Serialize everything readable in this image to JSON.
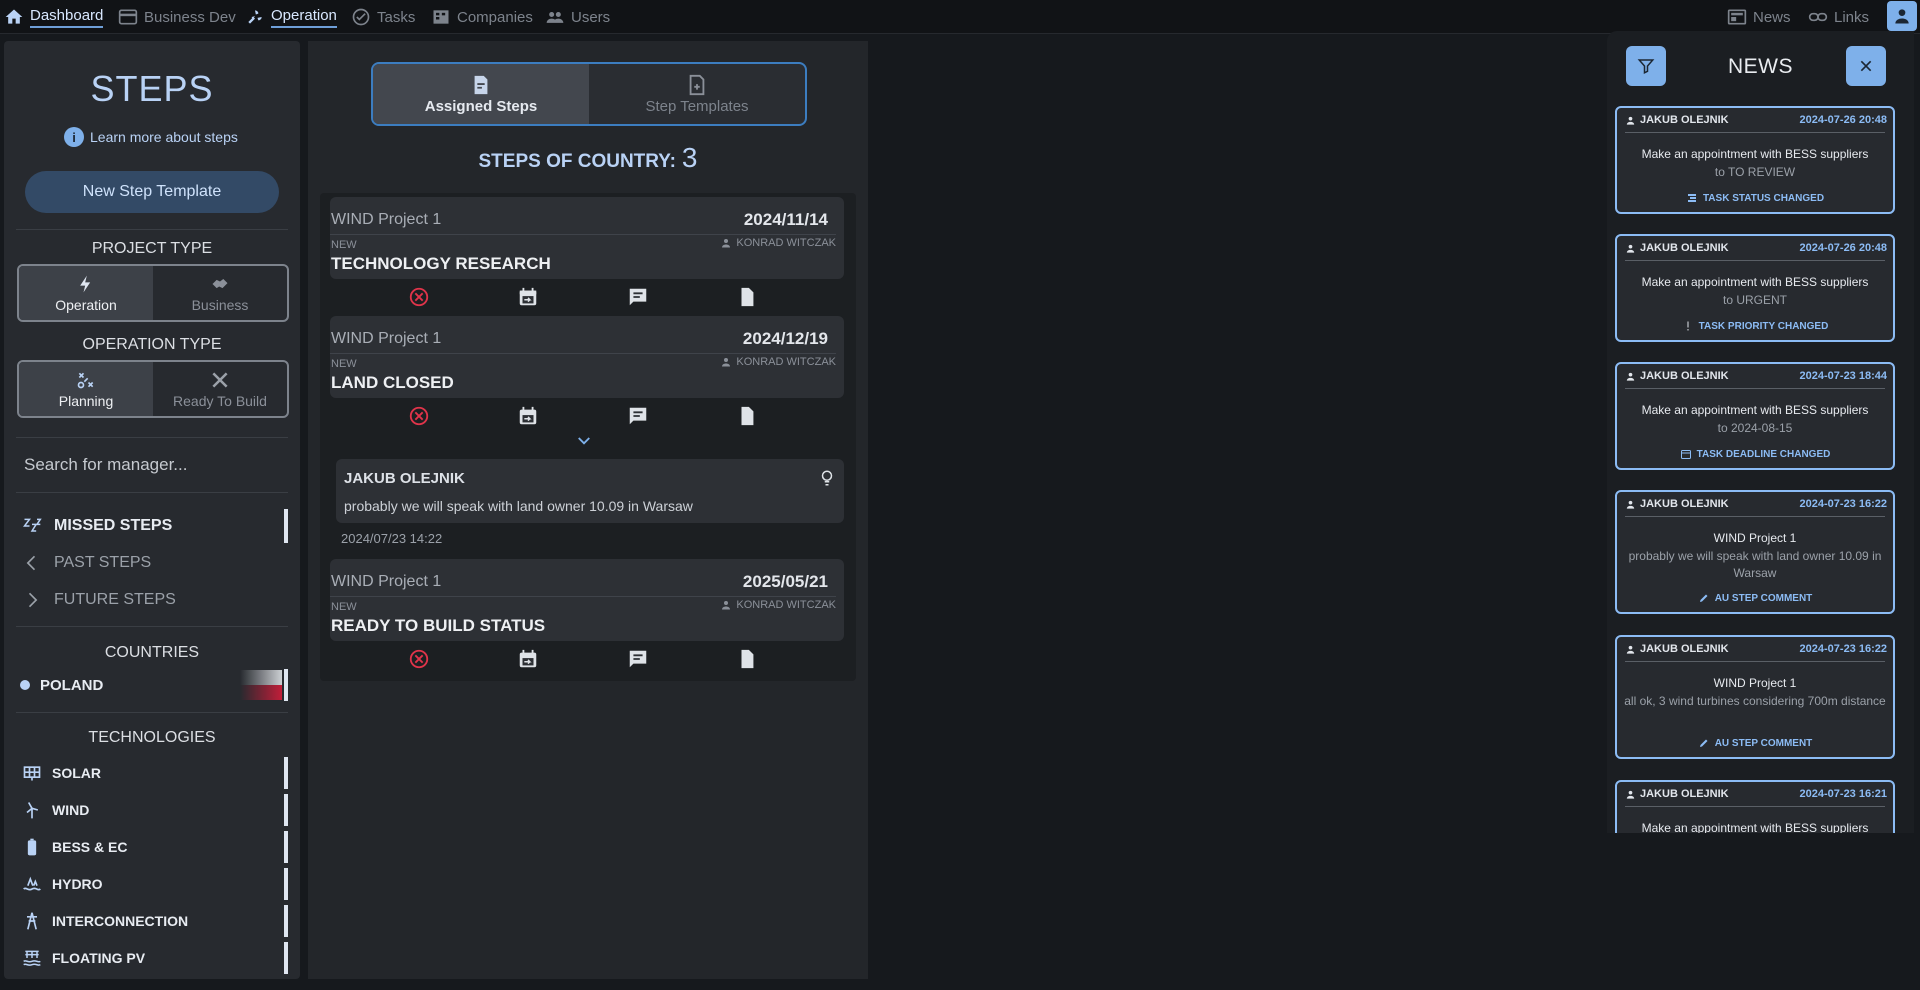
{
  "nav": {
    "items": [
      {
        "label": "Dashboard",
        "icon": "home-icon"
      },
      {
        "label": "Business Dev",
        "icon": "card-icon"
      },
      {
        "label": "Operation",
        "icon": "wind-tool-icon"
      },
      {
        "label": "Tasks",
        "icon": "check-circle-icon"
      },
      {
        "label": "Companies",
        "icon": "building-icon"
      },
      {
        "label": "Users",
        "icon": "users-icon"
      }
    ],
    "right": [
      {
        "label": "News",
        "icon": "newspaper-icon"
      },
      {
        "label": "Links",
        "icon": "link-icon"
      }
    ]
  },
  "sidebar": {
    "title": "STEPS",
    "learn_more": "Learn more about steps",
    "new_template": "New Step Template",
    "project_type_label": "PROJECT TYPE",
    "project_types": [
      "Operation",
      "Business"
    ],
    "operation_type_label": "OPERATION TYPE",
    "operation_types": [
      "Planning",
      "Ready To Build"
    ],
    "search_placeholder": "Search for manager...",
    "filters": [
      "MISSED STEPS",
      "PAST STEPS",
      "FUTURE STEPS"
    ],
    "countries_label": "COUNTRIES",
    "countries": [
      "POLAND"
    ],
    "technologies_label": "TECHNOLOGIES",
    "technologies": [
      "SOLAR",
      "WIND",
      "BESS & EC",
      "HYDRO",
      "INTERCONNECTION",
      "FLOATING PV"
    ]
  },
  "main": {
    "tabs": [
      "Assigned Steps",
      "Step Templates"
    ],
    "count_label": "STEPS OF COUNTRY:",
    "count_value": "3",
    "steps": [
      {
        "project": "WIND Project 1",
        "date": "2024/11/14",
        "status": "NEW",
        "owner": "KONRAD WITCZAK",
        "name": "TECHNOLOGY RESEARCH"
      },
      {
        "project": "WIND Project 1",
        "date": "2024/12/19",
        "status": "NEW",
        "owner": "KONRAD WITCZAK",
        "name": "LAND CLOSED"
      },
      {
        "project": "WIND Project 1",
        "date": "2025/05/21",
        "status": "NEW",
        "owner": "KONRAD WITCZAK",
        "name": "READY TO BUILD STATUS"
      }
    ],
    "comment": {
      "author": "JAKUB OLEJNIK",
      "text": "probably we will speak with land owner 10.09 in Warsaw",
      "time": "2024/07/23 14:22"
    }
  },
  "news": {
    "title": "NEWS",
    "items": [
      {
        "author": "JAKUB OLEJNIK",
        "time": "2024-07-26 20:48",
        "message": "Make an appointment with BESS suppliers",
        "detail": "to TO REVIEW",
        "kind": "TASK STATUS CHANGED"
      },
      {
        "author": "JAKUB OLEJNIK",
        "time": "2024-07-26 20:48",
        "message": "Make an appointment with BESS suppliers",
        "detail": "to URGENT",
        "kind": "TASK PRIORITY CHANGED"
      },
      {
        "author": "JAKUB OLEJNIK",
        "time": "2024-07-23 18:44",
        "message": "Make an appointment with BESS suppliers",
        "detail": "to 2024-08-15",
        "kind": "TASK DEADLINE CHANGED"
      },
      {
        "author": "JAKUB OLEJNIK",
        "time": "2024-07-23 16:22",
        "message": "WIND Project 1",
        "detail": "probably we will speak with land owner 10.09 in Warsaw",
        "kind": "AU STEP COMMENT"
      },
      {
        "author": "JAKUB OLEJNIK",
        "time": "2024-07-23 16:22",
        "message": "WIND Project 1",
        "detail": "all ok, 3 wind turbines considering 700m distance",
        "kind": "AU STEP COMMENT"
      },
      {
        "author": "JAKUB OLEJNIK",
        "time": "2024-07-23 16:21",
        "message": "Make an appointment with BESS suppliers",
        "detail": "",
        "kind": ""
      }
    ]
  },
  "colors": {
    "accent": "#7eb0ea",
    "delete": "#e0344a"
  }
}
